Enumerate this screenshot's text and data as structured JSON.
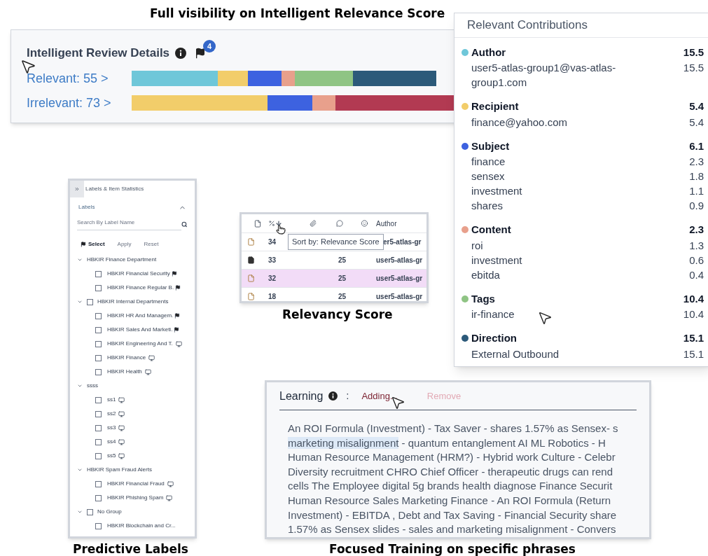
{
  "captions": [
    {
      "text": "Full visibility on Intelligent Relevance Score"
    },
    {
      "text": "Relevancy Score"
    },
    {
      "text": "Predictive Labels"
    },
    {
      "text": "Focused Training on specific phrases"
    }
  ],
  "review": {
    "title": "Intelligent Review Details",
    "flag_badge": "4",
    "rows": [
      {
        "label": "Relevant: 55 >",
        "segments": [
          {
            "color": "#6fc7d9"
          },
          {
            "color": "#f2cd6a"
          },
          {
            "color": "#3d62e0"
          },
          {
            "color": "#e8a08c"
          },
          {
            "color": "#8fc484"
          },
          {
            "color": "#2c5a7a"
          }
        ]
      },
      {
        "label": "Irrelevant: 73 >",
        "segments": [
          {
            "color": "#f2cd6a"
          },
          {
            "color": "#3d62e0"
          },
          {
            "color": "#e8a08c"
          },
          {
            "color": "#b23a52"
          }
        ]
      }
    ]
  },
  "contributions": {
    "title": "Relevant Contributions",
    "sections": [
      {
        "name": "Author",
        "color": "#6fc7d9",
        "total": "15.5",
        "items": [
          {
            "label": "user5-atlas-group1@vas-atlas-group1.com",
            "value": "15.5"
          }
        ]
      },
      {
        "name": "Recipient",
        "color": "#f2cd6a",
        "total": "5.4",
        "items": [
          {
            "label": "finance@yahoo.com",
            "value": "5.4"
          }
        ]
      },
      {
        "name": "Subject",
        "color": "#3d62e0",
        "total": "6.1",
        "items": [
          {
            "label": "finance",
            "value": "2.3"
          },
          {
            "label": "sensex",
            "value": "1.8"
          },
          {
            "label": "investment",
            "value": "1.1"
          },
          {
            "label": "shares",
            "value": "0.9"
          }
        ]
      },
      {
        "name": "Content",
        "color": "#e8a08c",
        "total": "2.3",
        "items": [
          {
            "label": "roi",
            "value": "1.3"
          },
          {
            "label": "investment",
            "value": "0.6"
          },
          {
            "label": "ebitda",
            "value": "0.4"
          }
        ]
      },
      {
        "name": "Tags",
        "color": "#8fc484",
        "total": "10.4",
        "items": [
          {
            "label": "ir-finance",
            "value": "10.4"
          }
        ]
      },
      {
        "name": "Direction",
        "color": "#2c5a7a",
        "total": "15.1",
        "items": [
          {
            "label": "External Outbound",
            "value": "15.1"
          }
        ]
      }
    ]
  },
  "labels_panel": {
    "title": "Labels & Item Statistics",
    "section": "Labels",
    "expanded": true,
    "search_placeholder": "Search By Label Name",
    "actions": [
      {
        "label": "Select",
        "disabled": false
      },
      {
        "label": "Apply",
        "disabled": true
      },
      {
        "label": "Reset",
        "disabled": true
      }
    ],
    "groups": [
      {
        "name": "HBKIR Finance Department",
        "kind": "plain",
        "expanded": true,
        "children": [
          {
            "name": "HBKIR Financial Security",
            "kind": "flag",
            "checked": false
          },
          {
            "name": "HBKIR Finance Regular B.",
            "kind": "flag",
            "checked": false
          }
        ]
      },
      {
        "name": "HBKIR Internal Departments",
        "kind": "checkbox",
        "checked": false,
        "expanded": true,
        "children": [
          {
            "name": "HBKIR HR And Managem.",
            "kind": "flag",
            "checked": false
          },
          {
            "name": "HBKIR Sales And Marketi.",
            "kind": "flag",
            "checked": false
          },
          {
            "name": "HBKIR Engineering And T.",
            "kind": "monitor",
            "checked": false
          },
          {
            "name": "HBKIR Finance",
            "kind": "monitor",
            "checked": false
          },
          {
            "name": "HBKIR Health",
            "kind": "monitor",
            "checked": false
          }
        ]
      },
      {
        "name": "ssss",
        "kind": "plain",
        "expanded": true,
        "children": [
          {
            "name": "ss1",
            "kind": "monitor",
            "checked": false
          },
          {
            "name": "ss2",
            "kind": "monitor",
            "checked": false
          },
          {
            "name": "ss3",
            "kind": "monitor",
            "checked": false
          },
          {
            "name": "ss4",
            "kind": "monitor",
            "checked": false
          },
          {
            "name": "ss5",
            "kind": "monitor",
            "checked": false
          }
        ]
      },
      {
        "name": "HBKIR Spam Fraud Alerts",
        "kind": "plain",
        "expanded": true,
        "children": [
          {
            "name": "HBKIR Financial Fraud",
            "kind": "monitor",
            "checked": false
          },
          {
            "name": "HBKIR Phishing Spam",
            "kind": "monitor",
            "checked": false
          }
        ]
      },
      {
        "name": "No Group",
        "kind": "checkbox",
        "checked": false,
        "expanded": true,
        "children": [
          {
            "name": "HBKIR Blockchain and Cr...",
            "kind": "plain",
            "checked": false
          }
        ]
      }
    ]
  },
  "items_table": {
    "author_header": "Author",
    "tooltip": "Sort by: Relevance Score",
    "rows": [
      {
        "kind": "outline",
        "score": "34",
        "author": "er5-atlas-gr",
        "selected": false
      },
      {
        "kind": "filled",
        "score": "33",
        "count": "25",
        "author": "user5-atlas-gr",
        "selected": false
      },
      {
        "kind": "outline",
        "score": "32",
        "count": "25",
        "author": "user5-atlas-gr",
        "selected": true
      },
      {
        "kind": "outline",
        "score": "18",
        "count": "25",
        "author": "user5-atlas-gr",
        "selected": false
      }
    ]
  },
  "learning": {
    "title": "Learning",
    "separator": ":",
    "actions": [
      {
        "label": "Adding...",
        "disabled": false
      },
      {
        "label": "Remove",
        "disabled": true
      }
    ],
    "lines": [
      {
        "text": "An ROI Formula (Investment) - Tax Saver - shares 1.57% as Sensex- s"
      },
      {
        "highlight": "marketing misalignment",
        "text": " - quantum entanglement AI ML Robotics - H"
      },
      {
        "text": "Human Resource Management (HRM?) - Hybrid work Culture - Celebr"
      },
      {
        "text": "Diversity recruitment CHRO Chief Officer - therapeutic drugs can rend"
      },
      {
        "text": "cells The Employee digital 5g brands health diagnose Finance Securit"
      },
      {
        "text": "Human Resource Sales Marketing Finance - An ROI Formula (Return"
      },
      {
        "text": "Investment) - EBITDA , Debt and Tax Saving - Financial Security share"
      },
      {
        "text": "1.57% as Sensex slides - sales and marketing misalignment - Convers"
      }
    ]
  }
}
